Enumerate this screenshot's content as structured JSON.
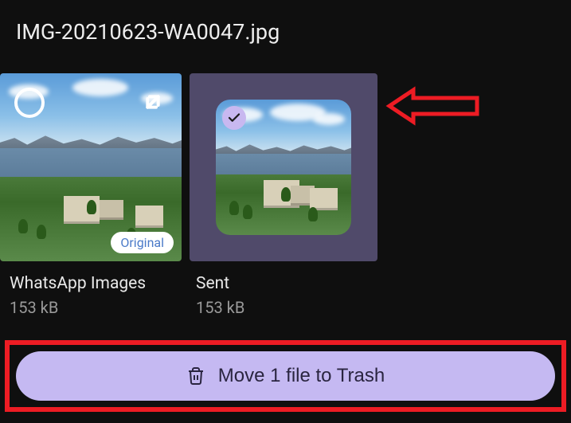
{
  "title": "IMG-20210623-WA0047.jpg",
  "thumbnails": [
    {
      "label": "WhatsApp Images",
      "size": "153 kB",
      "badge": "Original"
    },
    {
      "label": "Sent",
      "size": "153 kB"
    }
  ],
  "action_button": {
    "label": "Move 1 file to Trash"
  },
  "colors": {
    "accent": "#c5b9f2",
    "highlight": "#ed1c24"
  }
}
